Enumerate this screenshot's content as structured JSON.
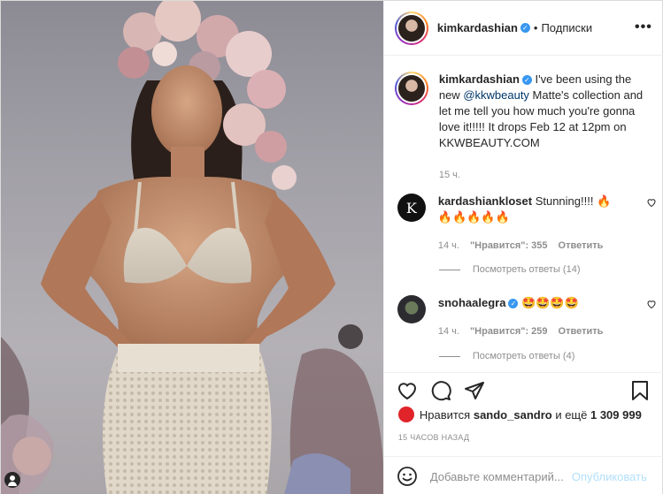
{
  "post": {
    "author": "kimkardashian",
    "verified_mark": "✓",
    "separator": "•",
    "follow_label": "Подписки",
    "more_label": "•••"
  },
  "caption": {
    "author": "kimkardashian",
    "text_before": "I've been using the new ",
    "mention": "@kkwbeauty",
    "text_after": " Matte's collection and let me tell you how much you're gonna love it!!!!! It drops Feb 12 at 12pm on KKWBEAUTY.COM",
    "time": "15 ч."
  },
  "comments": [
    {
      "author": "kardashiankloset",
      "avatar_letter": "K",
      "text": "Stunning!!!! 🔥🔥🔥🔥🔥🔥",
      "time": "14 ч.",
      "likes": "\"Нравится\": 355",
      "reply": "Ответить",
      "view_replies": "Посмотреть ответы (14)"
    },
    {
      "author": "snohaalegra",
      "verified": true,
      "text": "🤩🤩🤩🤩",
      "time": "14 ч.",
      "likes": "\"Нравится\": 259",
      "reply": "Ответить",
      "view_replies": "Посмотреть ответы (4)"
    }
  ],
  "likes": {
    "prefix": "Нравится",
    "user": "sando_sandro",
    "middle": "и ещё",
    "count": "1 309 999"
  },
  "post_time": "15 ЧАСОВ НАЗАД",
  "comment_box": {
    "placeholder": "Добавьте комментарий...",
    "publish_label": "Опубликовать"
  },
  "icons": {
    "like": "heart-icon",
    "comment": "comment-icon",
    "share": "share-icon",
    "save": "bookmark-icon",
    "emoji": "emoji-icon",
    "more": "more-icon",
    "user_tag": "user-tag-icon"
  },
  "colors": {
    "verified": "#3897f0",
    "link": "#00376b",
    "muted": "#8e8e8e",
    "publish_disabled": "#b2dffc"
  }
}
